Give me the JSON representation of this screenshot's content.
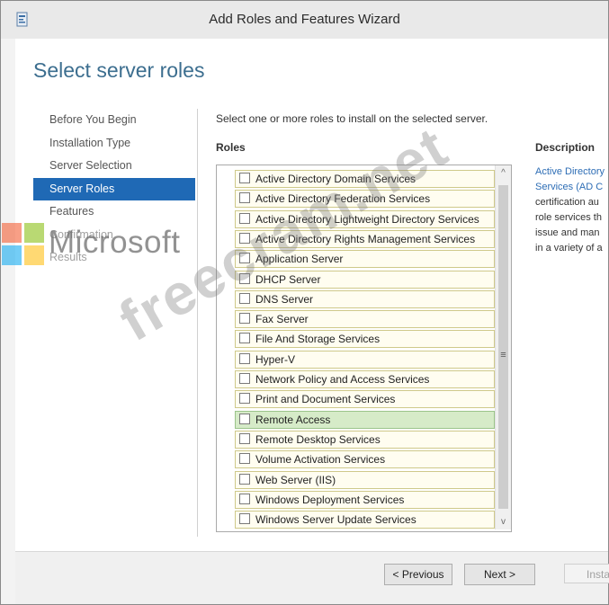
{
  "window": {
    "title": "Add Roles and Features Wizard"
  },
  "page": {
    "heading": "Select server roles"
  },
  "nav": {
    "items": [
      {
        "label": "Before You Begin",
        "state": "normal"
      },
      {
        "label": "Installation Type",
        "state": "normal"
      },
      {
        "label": "Server Selection",
        "state": "normal"
      },
      {
        "label": "Server Roles",
        "state": "active"
      },
      {
        "label": "Features",
        "state": "normal"
      },
      {
        "label": "Confirmation",
        "state": "dim"
      },
      {
        "label": "Results",
        "state": "dim"
      }
    ]
  },
  "content": {
    "instruction": "Select one or more roles to install on the selected server.",
    "roles_header": "Roles",
    "description_header": "Description",
    "description_lines": [
      "Active Directory",
      "Services (AD C",
      "certification au",
      "role services th",
      "issue and man",
      "in a variety of a"
    ]
  },
  "roles": [
    {
      "label": "Active Directory Domain Services",
      "checked": false,
      "selected": false
    },
    {
      "label": "Active Directory Federation Services",
      "checked": false,
      "selected": false
    },
    {
      "label": "Active Directory Lightweight Directory Services",
      "checked": false,
      "selected": false
    },
    {
      "label": "Active Directory Rights Management Services",
      "checked": false,
      "selected": false
    },
    {
      "label": "Application Server",
      "checked": false,
      "selected": false
    },
    {
      "label": "DHCP Server",
      "checked": false,
      "selected": false
    },
    {
      "label": "DNS Server",
      "checked": false,
      "selected": false
    },
    {
      "label": "Fax Server",
      "checked": false,
      "selected": false
    },
    {
      "label": "File And Storage Services",
      "checked": false,
      "selected": false
    },
    {
      "label": "Hyper-V",
      "checked": false,
      "selected": false
    },
    {
      "label": "Network Policy and Access Services",
      "checked": false,
      "selected": false
    },
    {
      "label": "Print and Document Services",
      "checked": false,
      "selected": false
    },
    {
      "label": "Remote Access",
      "checked": false,
      "selected": true
    },
    {
      "label": "Remote Desktop Services",
      "checked": false,
      "selected": false
    },
    {
      "label": "Volume Activation Services",
      "checked": false,
      "selected": false
    },
    {
      "label": "Web Server (IIS)",
      "checked": false,
      "selected": false
    },
    {
      "label": "Windows Deployment Services",
      "checked": false,
      "selected": false
    },
    {
      "label": "Windows Server Update Services",
      "checked": false,
      "selected": false
    }
  ],
  "scrollbar": {
    "up": "^",
    "down": "v",
    "grip": "≡"
  },
  "buttons": {
    "previous": "< Previous",
    "next": "Next >",
    "install": "Insta"
  },
  "overlay": {
    "watermark": "freecram.net",
    "brand": "Microsoft"
  },
  "colors": {
    "accent": "#1f69b5",
    "heading": "#3c6e8f",
    "selected_row": "#d6ebc8",
    "row_bg": "#fffdf0"
  }
}
